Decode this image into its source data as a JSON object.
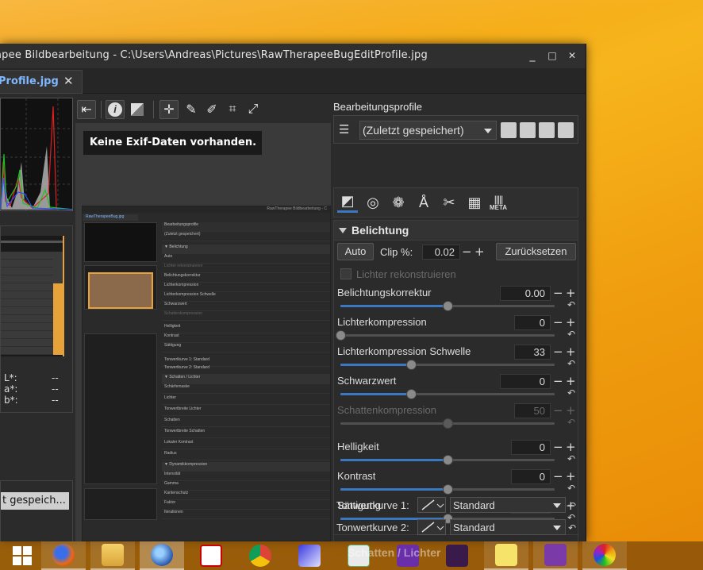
{
  "window": {
    "title": "apee Bildbearbeitung - C:\\Users\\Andreas\\Pictures\\RawTherapeeBugEditProfile.jpg",
    "minimize": "_",
    "maximize": "□",
    "close": "✕"
  },
  "tab": {
    "label": "Profile.jpg",
    "close": "✕"
  },
  "left_panel": {
    "lab": [
      {
        "label": "L*:",
        "value": "--"
      },
      {
        "label": "a*:",
        "value": "--"
      },
      {
        "label": "b*:",
        "value": "--"
      }
    ],
    "history_item": "t gespeich..."
  },
  "toolbar": {
    "icons": [
      "collapse-left-icon",
      "info-icon",
      "before-after-icon",
      "crosshair-icon",
      "color-picker-icon",
      "white-balance-picker-icon",
      "crop-icon",
      "straighten-icon"
    ]
  },
  "preview": {
    "exif_message": "Keine Exif-Daten vorhanden."
  },
  "profiles": {
    "label": "Bearbeitungsprofile",
    "selected": "(Zuletzt gespeichert)"
  },
  "tools": {
    "tabs": [
      "exposure-tab-icon",
      "detail-tab-icon",
      "color-tab-icon",
      "advanced-tab-icon",
      "transform-tab-icon",
      "raw-tab-icon",
      "metadata-tab-icon"
    ],
    "meta_label": "META"
  },
  "exposure": {
    "title": "Belichtung",
    "auto_label": "Auto",
    "clip_label": "Clip %:",
    "clip_value": "0.02",
    "reset_label": "Zurücksetzen",
    "highlight_reconstruct": "Lichter rekonstruieren",
    "sliders": [
      {
        "label": "Belichtungskorrektur",
        "value": "0.00",
        "enabled": true,
        "position": 0.5
      },
      {
        "label": "Lichterkompression",
        "value": "0",
        "enabled": true,
        "position": 0.0
      },
      {
        "label": "Lichterkompression Schwelle",
        "value": "33",
        "enabled": true,
        "position": 0.33
      },
      {
        "label": "Schwarzwert",
        "value": "0",
        "enabled": true,
        "position": 0.33
      },
      {
        "label": "Schattenkompression",
        "value": "50",
        "enabled": false,
        "position": 0.5
      },
      {
        "label": "Helligkeit",
        "value": "0",
        "enabled": true,
        "position": 0.5
      },
      {
        "label": "Kontrast",
        "value": "0",
        "enabled": true,
        "position": 0.5
      },
      {
        "label": "Sättigung",
        "value": "0",
        "enabled": true,
        "position": 0.5
      }
    ],
    "curve1_label": "Tonwertkurve 1:",
    "curve1_value": "Standard",
    "curve2_label": "Tonwertkurve 2:",
    "curve2_value": "Standard"
  },
  "taskbar": {
    "apps": [
      "windows-start-icon",
      "firefox-icon",
      "file-explorer-icon",
      "thunderbird-icon",
      "adobe-cs-eagle-icon",
      "chrome-icon",
      "network-tool-icon",
      "notepad-plus-icon",
      "visual-studio-icon",
      "media-app-icon",
      "sticky-notes-icon",
      "mathcad-icon",
      "rawtherapee-icon"
    ],
    "ghost_text": "Schatten / Lichter"
  }
}
